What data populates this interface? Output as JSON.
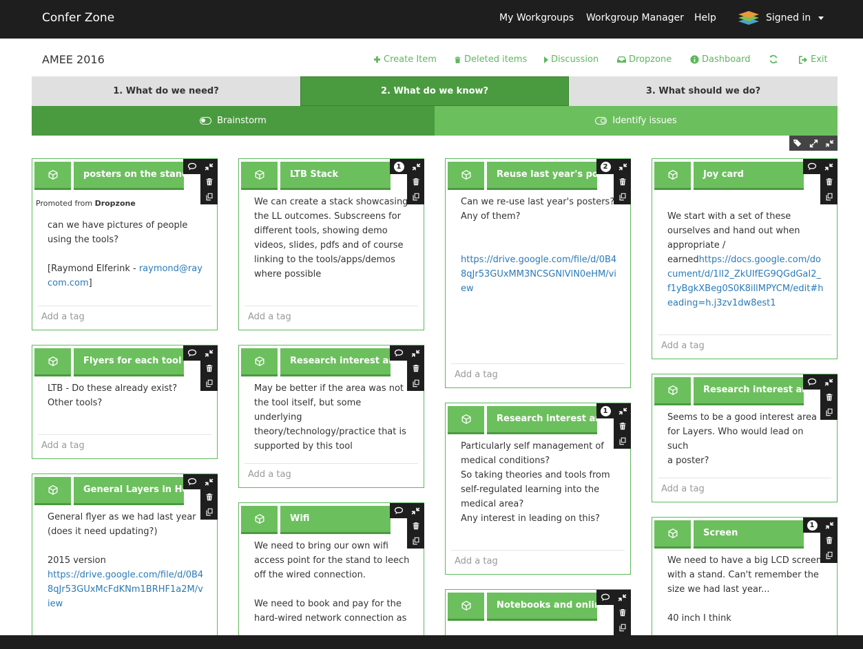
{
  "navbar": {
    "brand": "Confer Zone",
    "links": [
      "My Workgroups",
      "Workgroup Manager",
      "Help"
    ],
    "signed_in": "Signed in"
  },
  "workgroup": {
    "title": "AMEE 2016",
    "actions": {
      "create": "Create Item",
      "deleted": "Deleted items",
      "discussion": "Discussion",
      "dropzone": "Dropzone",
      "dashboard": "Dashboard",
      "exit": "Exit"
    }
  },
  "steps": [
    "1. What do we need?",
    "2. What do we know?",
    "3. What should we do?"
  ],
  "active_step": 1,
  "modes": [
    "Brainstorm",
    "Identify issues"
  ],
  "active_mode": 0,
  "tag_placeholder": "Add a tag",
  "cards": [
    {
      "title": "posters on the stand",
      "promoted_prefix": "Promoted from ",
      "promoted_source": "Dropzone",
      "body_text": "can we have pictures of people\nusing the tools?\n\n[Raymond Elferink - ",
      "body_link": "raymond@raycom.com",
      "body_after": "]",
      "tag_placeholder": "Add a tag"
    },
    {
      "title": "LTB Stack",
      "comment_count": "1",
      "body_text": "We can create a stack showcasing\nthe LL outcomes. Subscreens for\ndifferent tools, showing demo\nvideos, slides, pdfs and of course\nlinking to the tools/apps/demos\nwhere possible",
      "tag_placeholder": "Add a tag"
    },
    {
      "title": "Reuse last year's po",
      "comment_count": "2",
      "body_text": "Can we re-use last year's posters?\nAny of them?\n\n\n",
      "body_link": "https://drive.google.com/file/d/0B4\n8qJr53GUxMM3NCSGNlVlN0eHM/vi\new",
      "tag_placeholder": "Add a tag"
    },
    {
      "title": "Joy card",
      "body_text": "We start with a set of these\nourselves and hand out when\nappropriate /\nearned",
      "body_link": "https://docs.google.com/do\ncument/d/1lI2_ZkUIfEG9QGdGaI2_\nf1yBgkXBeg0S0K8illMPYCM/edit#h\neading=h.j3zv1dw8est1",
      "tag_placeholder": "Add a tag"
    },
    {
      "title": "Flyers for each tool",
      "body_text": "LTB - Do these already exist?\nOther tools?",
      "tag_placeholder": "Add a tag"
    },
    {
      "title": "Research interest ar",
      "body_text": "May be better if the area was not\nthe tool itself, but some underlying\ntheory/technology/practice that is\nsupported by this tool",
      "tag_placeholder": "Add a tag"
    },
    {
      "title": "Research interest ar",
      "comment_count": "1",
      "body_text": "Particularly self management of\nmedical conditions?\nSo taking theories and tools from\nself-regulated learning into the\nmedical area?\nAny interest in leading on this?",
      "tag_placeholder": "Add a tag"
    },
    {
      "title": "Research interest ar",
      "body_text": "Seems to be a good interest area\nfor Layers. Who would lead on such\na poster?",
      "tag_placeholder": "Add a tag"
    },
    {
      "title": "General Layers in He",
      "body_text": "General flyer as we had last year\n(does it need updating?)\n\n2015 version\n",
      "body_link": "https://drive.google.com/file/d/0B4\n8qJr53GUxMcFdKNm1BRHF1a2M/v\niew",
      "tag_placeholder": "Add a tag"
    },
    {
      "title": "Wifi",
      "body_text": "We need to bring our own wifi\naccess point for the stand to leech\noff the wired connection.\n\nWe need to book and pay for the\nhard-wired network connection as",
      "tag_placeholder": "Add a tag"
    },
    {
      "title": "Notebooks and onlir",
      "body_text": "",
      "tag_placeholder": "Add a tag"
    },
    {
      "title": "Screen",
      "comment_count": "1",
      "body_text": "We need to have a big LCD screen\nwith a stand. Can't remember the\nsize we had last year...\n\n40 inch I think",
      "tag_placeholder": "Add a tag"
    }
  ],
  "colors": {
    "navbar": "#1e1e1e",
    "accent": "#5cb85c",
    "accent_dark": "#4a9b3f",
    "header_light": "#6cbf5d",
    "link": "#2a7ab8"
  }
}
